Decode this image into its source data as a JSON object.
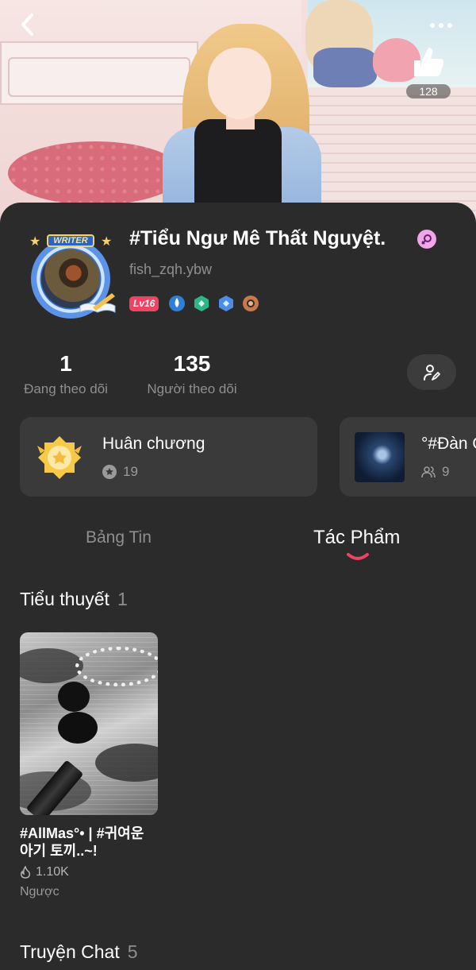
{
  "header": {
    "likes": "128"
  },
  "profile": {
    "name": "#Tiểu Ngư Mê Thất Nguyệt.",
    "handle": "fish_zqh.ybw",
    "level": "Lv16",
    "avatar_badge": "WRITER",
    "gender_icon": "female-icon"
  },
  "stats": {
    "following_count": "1",
    "following_label": "Đang theo dõi",
    "followers_count": "135",
    "followers_label": "Người theo dõi"
  },
  "cards": {
    "medal": {
      "title": "Huân chương",
      "count": "19"
    },
    "group": {
      "title": "°#Đàn Ô",
      "members": "9"
    }
  },
  "tabs": [
    {
      "label": "Bảng Tin",
      "active": false
    },
    {
      "label": "Tác Phẩm",
      "active": true
    }
  ],
  "sections": {
    "novels": {
      "title": "Tiểu thuyết",
      "count": "1",
      "items": [
        {
          "title": "#AllMas°• | #귀여운 아기 토끼..~!",
          "views": "1.10K",
          "genre": "Ngược"
        }
      ]
    },
    "chat_stories": {
      "title": "Truyện Chat",
      "count": "5"
    }
  },
  "colors": {
    "background": "#2b2b2b",
    "card": "#3a3a3a",
    "accent": "#f04262",
    "muted_text": "#8f8f8f"
  }
}
